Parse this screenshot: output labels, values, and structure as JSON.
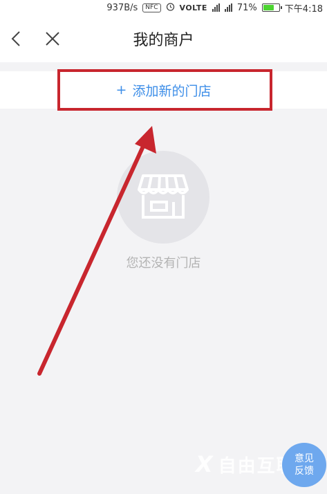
{
  "status_bar": {
    "speed": "937B/s",
    "nfc": "NFC",
    "alarm_icon": "alarm-clock-icon",
    "volte": "VOLTE",
    "battery_percent": "71%",
    "time": "下午4:18",
    "battery_level": 0.71
  },
  "header": {
    "title": "我的商户",
    "back_icon": "chevron-left-icon",
    "close_icon": "close-icon"
  },
  "add_store": {
    "plus": "+",
    "label": "添加新的门店"
  },
  "empty_state": {
    "icon": "storefront-icon",
    "message": "您还没有门店"
  },
  "feedback": {
    "line1": "意见",
    "line2": "反馈"
  },
  "watermark": {
    "mark": "X",
    "text": "自由互联"
  },
  "colors": {
    "accent": "#3d8ee8",
    "annotation": "#c8262e",
    "background": "#f3f3f5",
    "feedback_bg": "#6ea8ee"
  }
}
